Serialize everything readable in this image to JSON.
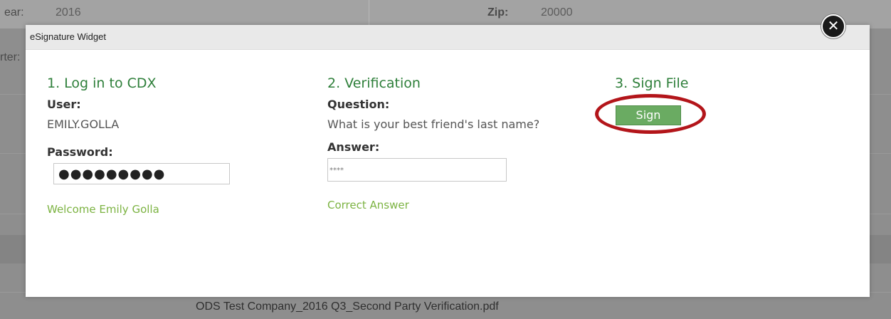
{
  "background": {
    "year_label": "ear:",
    "year_value": "2016",
    "zip_label": "Zip:",
    "zip_value": "20000",
    "quarter_label": "rter:",
    "file_name": "ODS Test Company_2016 Q3_Second Party Verification.pdf"
  },
  "modal": {
    "title": "eSignature Widget",
    "close_icon": "close-x-icon"
  },
  "step1": {
    "title": "1. Log in to CDX",
    "user_label": "User:",
    "user_value": "EMILY.GOLLA",
    "password_label": "Password:",
    "password_value": "●●●●●●●●●",
    "status": "Welcome Emily Golla"
  },
  "step2": {
    "title": "2. Verification",
    "question_label": "Question:",
    "question_text": "What is your best friend's last name?",
    "answer_label": "Answer:",
    "answer_value": "****",
    "status": "Correct Answer"
  },
  "step3": {
    "title": "3. Sign File",
    "sign_button": "Sign"
  },
  "colors": {
    "step_title": "#2e7f3a",
    "status_text": "#7cb342",
    "sign_button": "#6aab62",
    "highlight_ring": "#b3151a"
  }
}
